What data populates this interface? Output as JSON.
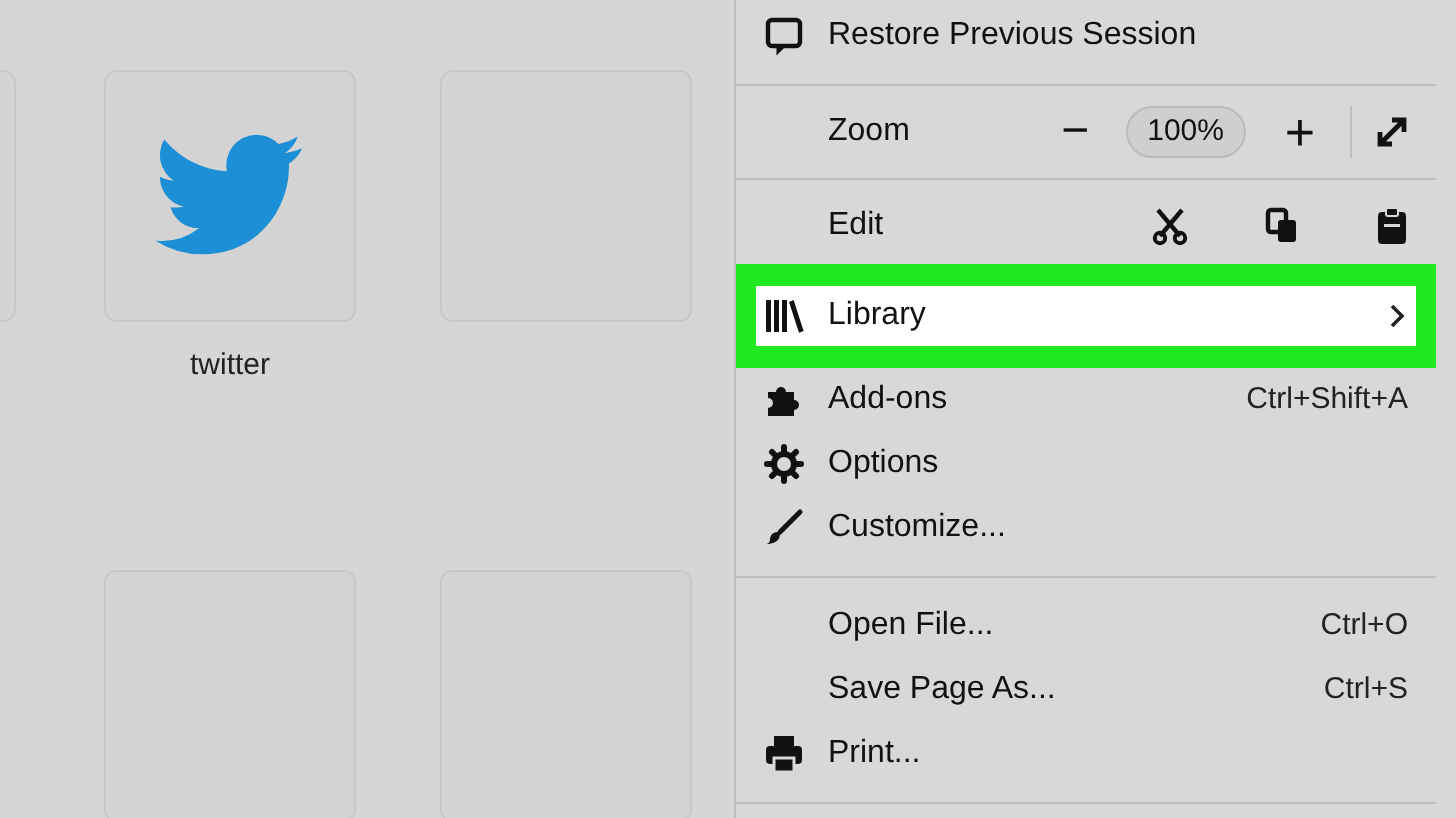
{
  "tiles": [
    {
      "kind": "empty"
    },
    {
      "kind": "site",
      "label": "twitter"
    },
    {
      "kind": "empty"
    },
    {
      "kind": "empty"
    },
    {
      "kind": "empty"
    }
  ],
  "menu": [
    {
      "kind": "item",
      "label": "Restore Previous Session",
      "selected": false
    },
    {
      "kind": "divider"
    },
    {
      "kind": "zoom",
      "label": "Zoom",
      "minus": "−",
      "value": "100%",
      "plus": "+"
    },
    {
      "kind": "divider"
    },
    {
      "kind": "edit",
      "label": "Edit"
    },
    {
      "kind": "item",
      "label": "Library",
      "submenu": true,
      "selected": true
    },
    {
      "kind": "item",
      "label": "Add-ons",
      "shortcut": "Ctrl+Shift+A",
      "selected": false
    },
    {
      "kind": "item",
      "label": "Options",
      "selected": false
    },
    {
      "kind": "item",
      "label": "Customize...",
      "selected": false
    },
    {
      "kind": "divider"
    },
    {
      "kind": "item",
      "label": "Open File...",
      "shortcut": "Ctrl+O",
      "selected": false
    },
    {
      "kind": "item",
      "label": "Save Page As...",
      "shortcut": "Ctrl+S",
      "selected": false
    },
    {
      "kind": "item",
      "label": "Print...",
      "selected": false
    },
    {
      "kind": "divider"
    }
  ]
}
